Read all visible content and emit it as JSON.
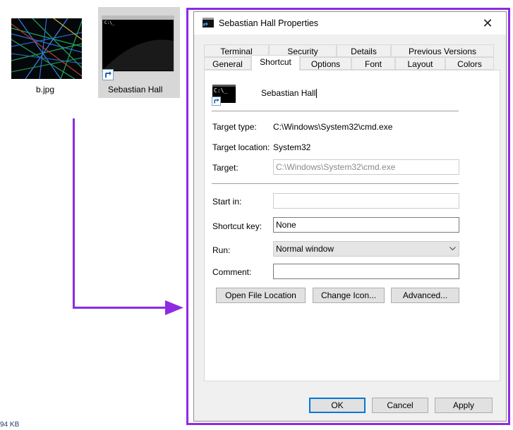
{
  "desktop": {
    "file1_name": "b.jpg",
    "file2_name": "Sebastian  Hall",
    "status_size": "94 KB",
    "cmd_thumb_text": "C:\\_"
  },
  "dialog": {
    "title": "Sebastian  Hall Properties",
    "close_glyph": "✕",
    "tabs_row1": [
      "Terminal",
      "Security",
      "Details",
      "Previous Versions"
    ],
    "tabs_row2": [
      "General",
      "Shortcut",
      "Options",
      "Font",
      "Layout",
      "Colors"
    ],
    "active_tab": "Shortcut",
    "shortcut_icon_text": "C:\\_",
    "shortcut_name": "Sebastian  Hall",
    "target_type_label": "Target type:",
    "target_type_value": "C:\\Windows\\System32\\cmd.exe",
    "target_location_label": "Target location:",
    "target_location_value": "System32",
    "target_label": "Target:",
    "target_value": "C:\\Windows\\System32\\cmd.exe",
    "start_in_label": "Start in:",
    "start_in_value": "",
    "shortcut_key_label": "Shortcut key:",
    "shortcut_key_value": "None",
    "run_label": "Run:",
    "run_value": "Normal window",
    "comment_label": "Comment:",
    "comment_value": "",
    "open_file_location": "Open File Location",
    "change_icon": "Change Icon...",
    "advanced": "Advanced...",
    "ok": "OK",
    "cancel": "Cancel",
    "apply": "Apply"
  },
  "colors": {
    "annotation": "#8e2be2",
    "accent": "#0078d7"
  }
}
